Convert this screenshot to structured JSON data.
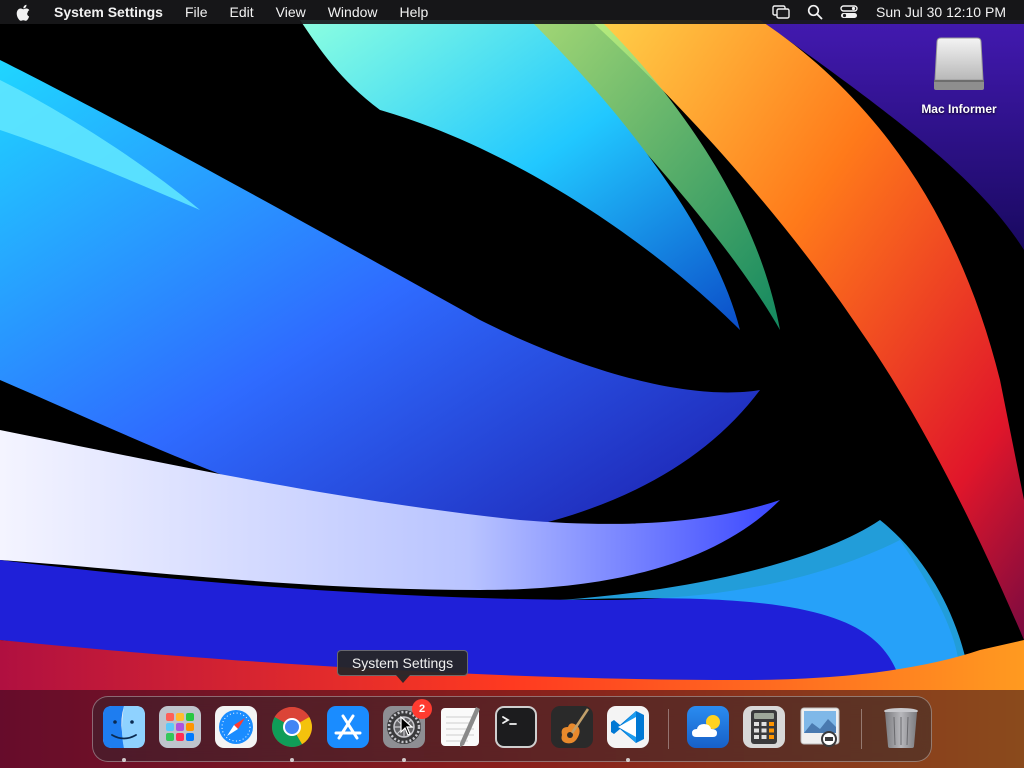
{
  "menubar": {
    "app_name": "System Settings",
    "menus": [
      "File",
      "Edit",
      "View",
      "Window",
      "Help"
    ],
    "status_icons": [
      "screen-mirroring-icon",
      "search-icon",
      "control-center-icon"
    ],
    "clock": "Sun Jul 30  12:10 PM"
  },
  "desktop": {
    "icons": [
      {
        "label": "Mac Informer",
        "icon": "external-disk-icon"
      }
    ]
  },
  "tooltip": {
    "text": "System Settings"
  },
  "dock": {
    "apps": [
      {
        "name": "Finder",
        "icon": "finder-icon",
        "running": true
      },
      {
        "name": "Launchpad",
        "icon": "launchpad-icon",
        "running": false
      },
      {
        "name": "Safari",
        "icon": "safari-icon",
        "running": false
      },
      {
        "name": "Google Chrome",
        "icon": "chrome-icon",
        "running": true
      },
      {
        "name": "App Store",
        "icon": "app-store-icon",
        "running": false
      },
      {
        "name": "System Settings",
        "icon": "system-settings-icon",
        "running": true,
        "badge": "2"
      },
      {
        "name": "TextEdit",
        "icon": "textedit-icon",
        "running": false
      },
      {
        "name": "Terminal",
        "icon": "terminal-icon",
        "running": false
      },
      {
        "name": "GarageBand",
        "icon": "garageband-icon",
        "running": false
      },
      {
        "name": "Visual Studio Code",
        "icon": "vscode-icon",
        "running": true
      },
      {
        "name": "Weather",
        "icon": "weather-icon",
        "running": false
      },
      {
        "name": "Calculator",
        "icon": "calculator-icon",
        "running": false
      },
      {
        "name": "Preview",
        "icon": "preview-icon",
        "running": false
      },
      {
        "name": "Trash",
        "icon": "trash-icon",
        "running": false
      }
    ]
  },
  "colors": {
    "menubar_bg": "#18181a",
    "badge": "#ff3b30",
    "accent_blue": "#1a8cff"
  }
}
